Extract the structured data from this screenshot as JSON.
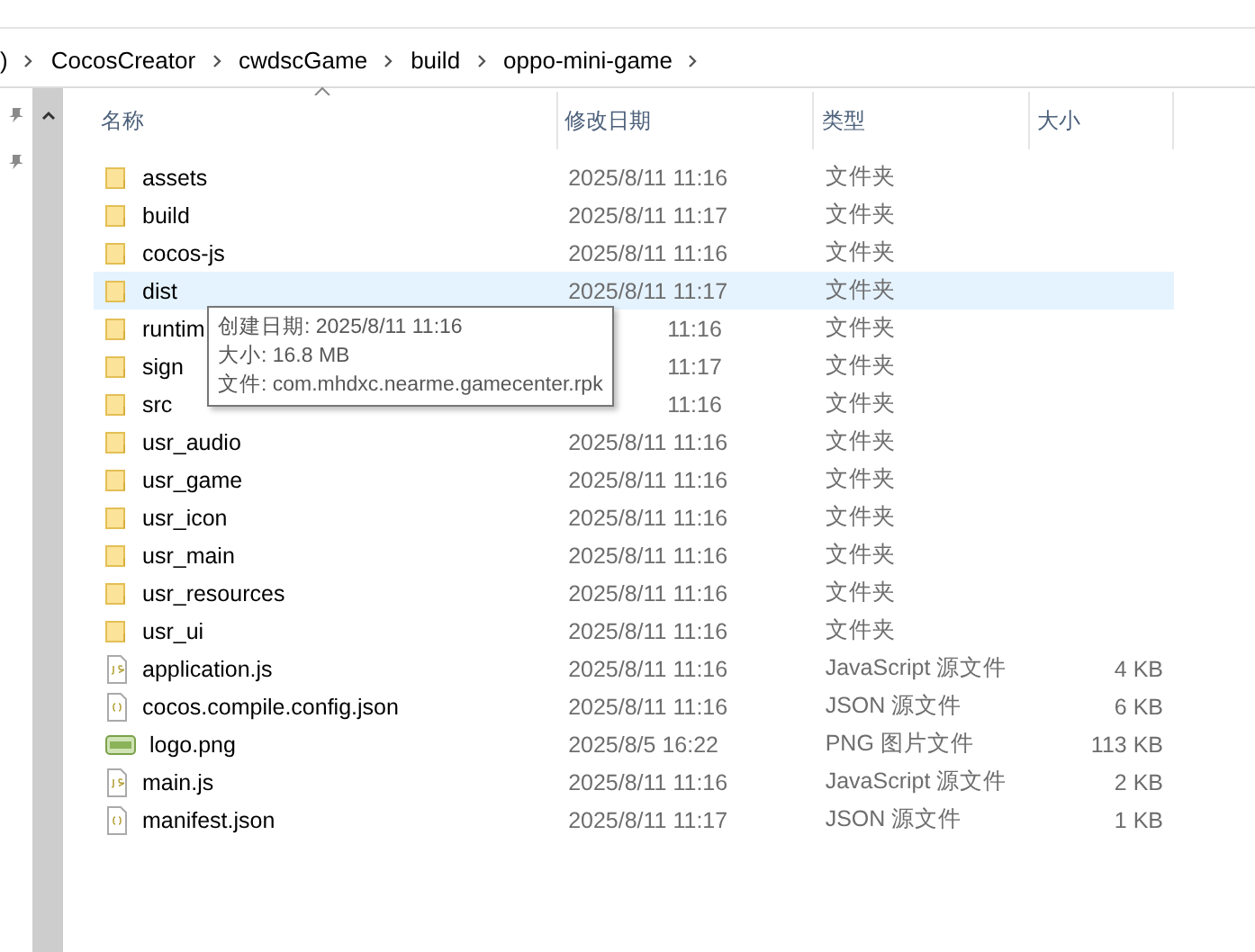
{
  "breadcrumb": [
    {
      "label": ")"
    },
    {
      "label": "CocosCreator"
    },
    {
      "label": "cwdscGame"
    },
    {
      "label": "build"
    },
    {
      "label": "oppo-mini-game"
    }
  ],
  "columns": [
    {
      "label": "名称",
      "sorted": true
    },
    {
      "label": "修改日期",
      "sorted": false
    },
    {
      "label": "类型",
      "sorted": false
    },
    {
      "label": "大小",
      "sorted": false
    }
  ],
  "rows": [
    {
      "kind": "folder",
      "name": "assets",
      "date": "2025/8/11 11:16",
      "type": "文件夹",
      "selected": false
    },
    {
      "kind": "folder",
      "name": "build",
      "date": "2025/8/11 11:17",
      "type": "文件夹",
      "selected": false
    },
    {
      "kind": "folder",
      "name": "cocos-js",
      "date": "2025/8/11 11:16",
      "type": "文件夹",
      "selected": false
    },
    {
      "kind": "folder",
      "name": "dist",
      "date": "2025/8/11 11:17",
      "type": "文件夹",
      "selected": true
    },
    {
      "kind": "folder",
      "name": "runtim",
      "date": "11:16",
      "type": "文件夹",
      "selected": false,
      "covered": true
    },
    {
      "kind": "folder",
      "name": "sign",
      "date": "11:17",
      "type": "文件夹",
      "selected": false,
      "covered": true
    },
    {
      "kind": "folder",
      "name": "src",
      "date": "11:16",
      "type": "文件夹",
      "selected": false,
      "covered": true
    },
    {
      "kind": "folder",
      "name": "usr_audio",
      "date": "2025/8/11 11:16",
      "type": "文件夹",
      "selected": false
    },
    {
      "kind": "folder",
      "name": "usr_game",
      "date": "2025/8/11 11:16",
      "type": "文件夹",
      "selected": false
    },
    {
      "kind": "folder",
      "name": "usr_icon",
      "date": "2025/8/11 11:16",
      "type": "文件夹",
      "selected": false
    },
    {
      "kind": "folder",
      "name": "usr_main",
      "date": "2025/8/11 11:16",
      "type": "文件夹",
      "selected": false
    },
    {
      "kind": "folder",
      "name": "usr_resources",
      "date": "2025/8/11 11:16",
      "type": "文件夹",
      "selected": false
    },
    {
      "kind": "folder",
      "name": "usr_ui",
      "date": "2025/8/11 11:16",
      "type": "文件夹",
      "selected": false
    },
    {
      "kind": "js",
      "name": "application.js",
      "date": "2025/8/11 11:16",
      "type": "JavaScript 源文件",
      "size": "4 KB",
      "selected": false
    },
    {
      "kind": "json",
      "name": "cocos.compile.config.json",
      "date": "2025/8/11 11:16",
      "type": "JSON 源文件",
      "size": "6 KB",
      "selected": false
    },
    {
      "kind": "png",
      "name": "logo.png",
      "date": "2025/8/5 16:22",
      "type": "PNG 图片文件",
      "size": "113 KB",
      "selected": false
    },
    {
      "kind": "js",
      "name": "main.js",
      "date": "2025/8/11 11:16",
      "type": "JavaScript 源文件",
      "size": "2 KB",
      "selected": false
    },
    {
      "kind": "json",
      "name": "manifest.json",
      "date": "2025/8/11 11:17",
      "type": "JSON 源文件",
      "size": "1 KB",
      "selected": false
    }
  ],
  "tooltip": [
    "创建日期: 2025/8/11 11:16",
    "大小: 16.8 MB",
    "文件: com.mhdxc.nearme.gamecenter.rpk"
  ]
}
